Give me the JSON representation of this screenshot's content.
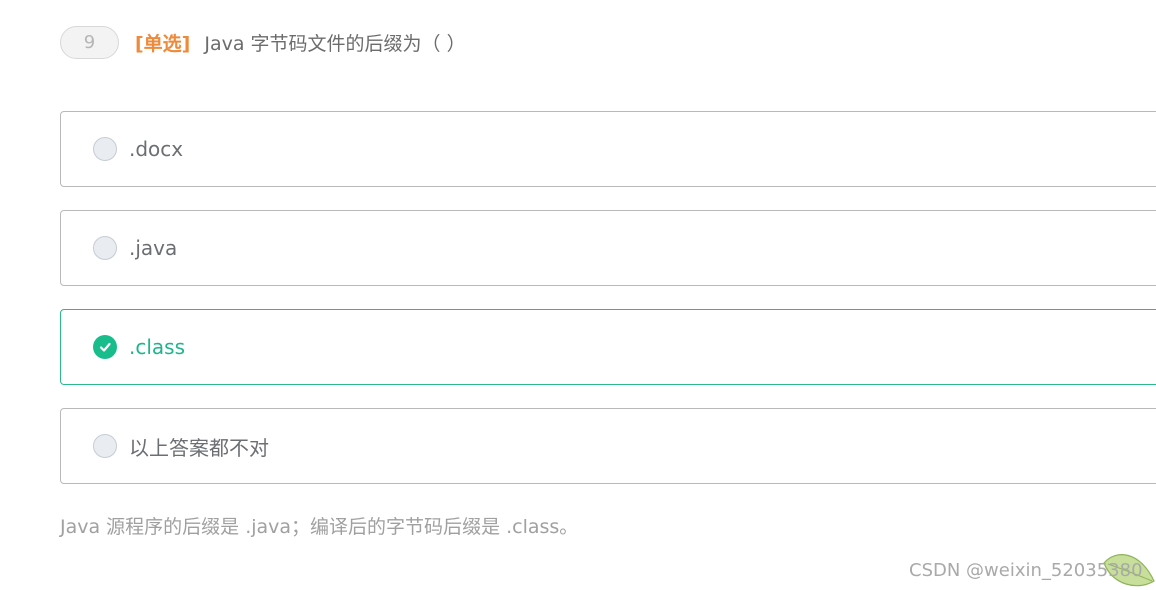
{
  "question": {
    "number": "9",
    "type_label": "[单选]",
    "text": "Java 字节码文件的后缀为（ ）"
  },
  "options": [
    {
      "label": ".docx",
      "selected": false
    },
    {
      "label": ".java",
      "selected": false
    },
    {
      "label": ".class",
      "selected": true
    },
    {
      "label": "以上答案都不对",
      "selected": false
    }
  ],
  "explanation": "Java 源程序的后缀是 .java；编译后的字节码后缀是 .class。",
  "watermark": "CSDN @weixin_52035380",
  "colors": {
    "accent_green": "#19bd8c",
    "type_orange": "#ee8a3a"
  },
  "icons": {
    "selected_option": "check-circle-icon",
    "unselected_option": "radio-empty-icon"
  }
}
